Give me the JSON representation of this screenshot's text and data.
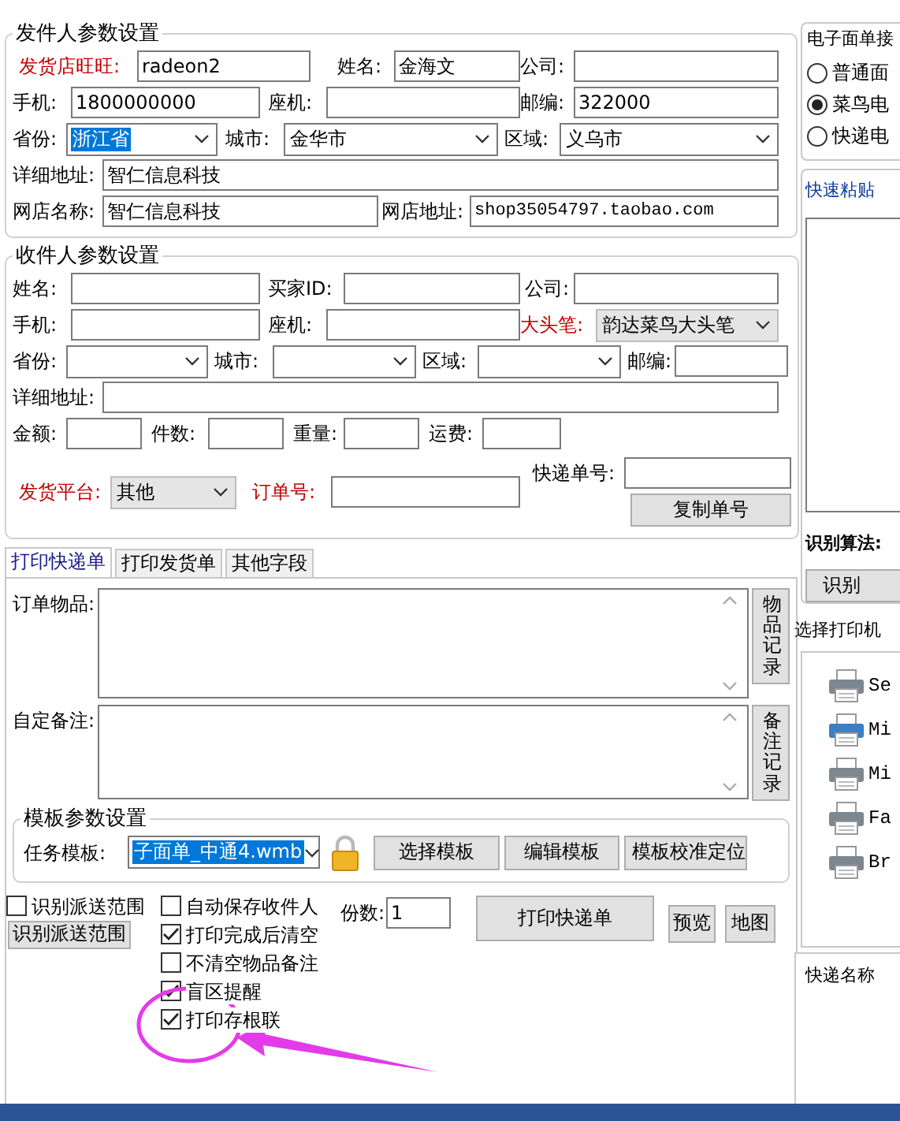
{
  "sender": {
    "title": "发件人参数设置",
    "fields": [
      {
        "label": "发货店旺旺:",
        "highlight": true,
        "kind": "input",
        "value": "radeon2"
      },
      {
        "label": "姓名:",
        "highlight": false,
        "kind": "input",
        "value": "金海文"
      },
      {
        "label": "公司:",
        "highlight": false,
        "kind": "input"
      },
      {
        "label": "手机:",
        "highlight": false,
        "kind": "input",
        "value": "1800000000"
      },
      {
        "label": "座机:",
        "highlight": false,
        "kind": "input"
      },
      {
        "label": "邮编:",
        "highlight": false,
        "kind": "input",
        "value": "322000"
      },
      {
        "label": "省份:",
        "highlight": false,
        "kind": "select",
        "value": "浙江省",
        "disabled": false,
        "focused": true
      },
      {
        "label": "城市:",
        "highlight": false,
        "kind": "select",
        "value": "金华市",
        "disabled": false,
        "focused": false
      },
      {
        "label": "区域:",
        "highlight": false,
        "kind": "select",
        "value": "义乌市",
        "disabled": false,
        "focused": false
      },
      {
        "label": "详细地址:",
        "highlight": false,
        "kind": "input",
        "value": "智仁信息科技"
      },
      {
        "label": "网店名称:",
        "highlight": false,
        "kind": "input",
        "value": "智仁信息科技"
      },
      {
        "label": "网店地址:",
        "highlight": false,
        "kind": "input",
        "value": "shop35054797.taobao.com"
      }
    ]
  },
  "receiver": {
    "title": "收件人参数设置",
    "fields": [
      {
        "label": "姓名:",
        "highlight": false,
        "kind": "input"
      },
      {
        "label": "买家ID:",
        "highlight": false,
        "kind": "input"
      },
      {
        "label": "公司:",
        "highlight": false,
        "kind": "input"
      },
      {
        "label": "手机:",
        "highlight": false,
        "kind": "input"
      },
      {
        "label": "座机:",
        "highlight": false,
        "kind": "input"
      },
      {
        "label": "大头笔:",
        "highlight": true,
        "kind": "select",
        "value": "韵达菜鸟大头笔",
        "disabled": true,
        "focused": false
      },
      {
        "label": "省份:",
        "highlight": false,
        "kind": "select",
        "disabled": false
      },
      {
        "label": "城市:",
        "highlight": false,
        "kind": "select",
        "disabled": false
      },
      {
        "label": "区域:",
        "highlight": false,
        "kind": "select",
        "disabled": false
      },
      {
        "label": "邮编:",
        "highlight": false,
        "kind": "input"
      },
      {
        "label": "详细地址:",
        "highlight": false,
        "kind": "input"
      },
      {
        "label": "金额:",
        "highlight": false,
        "kind": "input"
      },
      {
        "label": "件数:",
        "highlight": false,
        "kind": "input"
      },
      {
        "label": "重量:",
        "highlight": false,
        "kind": "input"
      },
      {
        "label": "运费:",
        "highlight": false,
        "kind": "input"
      },
      {
        "label": "发货平台:",
        "highlight": true,
        "kind": "select",
        "value": "其他",
        "disabled": true,
        "focused": false
      },
      {
        "label": "订单号:",
        "highlight": true,
        "kind": "input"
      },
      {
        "label": "快递单号:",
        "highlight": false,
        "kind": "input"
      }
    ],
    "copy_button": "复制单号"
  },
  "tabs": [
    {
      "label": "打印快递单",
      "selected": true
    },
    {
      "label": "打印发货单",
      "selected": false
    },
    {
      "label": "其他字段",
      "selected": false
    }
  ],
  "memos": [
    {
      "label": "订单物品:",
      "button": "物品记录"
    },
    {
      "label": "自定备注:",
      "button": "备注记录"
    }
  ],
  "template": {
    "title": "模板参数设置",
    "label": "任务模板:",
    "value": "子面单_中通4.wmb",
    "focused": true,
    "buttons": [
      "选择模板",
      "编辑模板",
      "模板校准定位"
    ]
  },
  "range": {
    "checkbox": {
      "label": "识别派送范围",
      "checked": false
    },
    "button": "识别派送范围"
  },
  "options": [
    {
      "label": "自动保存收件人",
      "checked": false
    },
    {
      "label": "打印完成后清空",
      "checked": true
    },
    {
      "label": "不清空物品备注",
      "checked": false
    },
    {
      "label": "盲区提醒",
      "checked": true
    },
    {
      "label": "打印存根联",
      "checked": true
    }
  ],
  "copies": {
    "label": "份数:",
    "value": "1"
  },
  "print_button": "打印快递单",
  "buttons": [
    "预览",
    "地图"
  ],
  "eform": {
    "title": "电子面单接",
    "options": [
      {
        "label": "普通面",
        "selected": false
      },
      {
        "label": "菜鸟电",
        "selected": true
      },
      {
        "label": "快递电",
        "selected": false
      }
    ]
  },
  "paste": {
    "title": "快速粘贴",
    "algorithm_label": "识别算法:",
    "button": "识别"
  },
  "printers": {
    "title": "选择打印机",
    "items": [
      {
        "name": "Se",
        "selected": false
      },
      {
        "name": "Mi",
        "selected": true
      },
      {
        "name": "Mi",
        "selected": false
      },
      {
        "name": "Fa",
        "selected": false
      },
      {
        "name": "Br",
        "selected": false
      }
    ]
  },
  "express": {
    "column": "快递名称"
  }
}
